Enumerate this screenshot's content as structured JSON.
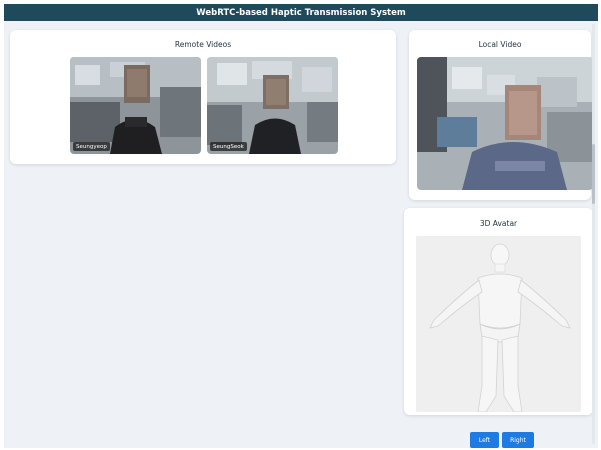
{
  "header": {
    "title": "WebRTC-based Haptic Transmission System"
  },
  "remote_videos": {
    "title": "Remote Videos",
    "participants": [
      {
        "name": "Seungyeop"
      },
      {
        "name": "SeungSeok"
      }
    ]
  },
  "local_video": {
    "title": "Local Video"
  },
  "avatar": {
    "title": "3D Avatar"
  },
  "controls": {
    "left_label": "Left",
    "right_label": "Right"
  },
  "colors": {
    "header_bg": "#1f4a5c",
    "page_bg": "#eef2f6",
    "button_bg": "#1e7be3"
  }
}
